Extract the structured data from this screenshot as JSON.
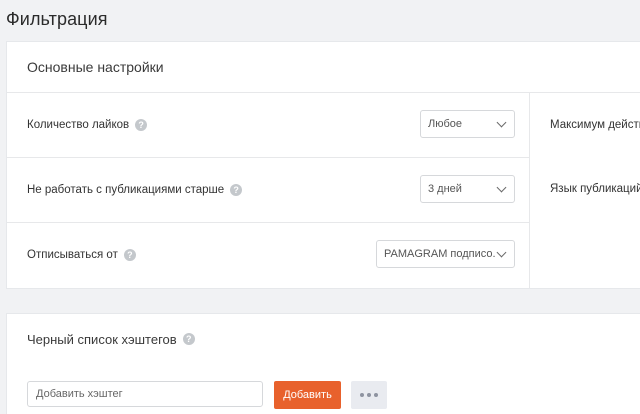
{
  "page": {
    "title": "Фильтрация"
  },
  "main_settings": {
    "title": "Основные настройки",
    "left_rows": [
      {
        "label": "Количество лайков",
        "value": "Любое"
      },
      {
        "label": "Не работать с публикациями старше",
        "value": "3 дней"
      },
      {
        "label": "Отписываться от",
        "value": "PAMAGRAM подписо.."
      }
    ],
    "right_rows": [
      {
        "label": "Максимум действи"
      },
      {
        "label": "Язык публикаций"
      }
    ]
  },
  "blacklist": {
    "title": "Черный список хэштегов",
    "input_placeholder": "Добавить хэштег",
    "add_label": "Добавить"
  },
  "icons": {
    "help": "question-icon",
    "dropdown": "chevron-down-icon",
    "more": "more-dots-icon"
  },
  "colors": {
    "accent": "#e8612c",
    "background": "#f1f2f4"
  }
}
